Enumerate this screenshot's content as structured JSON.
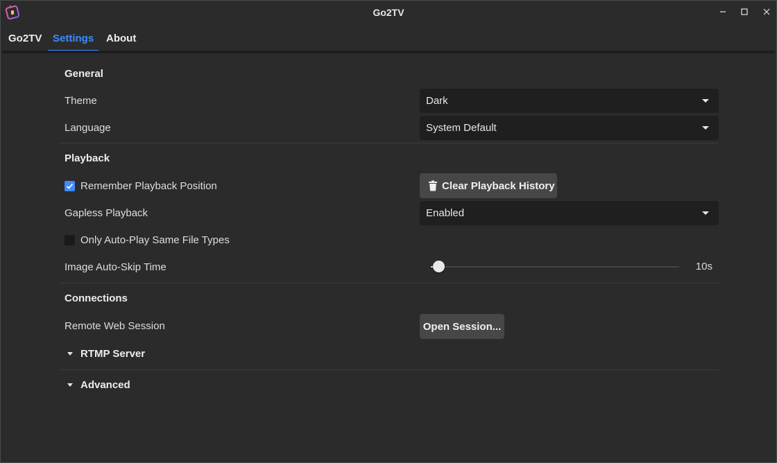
{
  "window": {
    "title": "Go2TV"
  },
  "tabs": [
    {
      "label": "Go2TV",
      "active": false
    },
    {
      "label": "Settings",
      "active": true
    },
    {
      "label": "About",
      "active": false
    }
  ],
  "sections": {
    "general": {
      "title": "General",
      "theme": {
        "label": "Theme",
        "value": "Dark"
      },
      "language": {
        "label": "Language",
        "value": "System Default"
      }
    },
    "playback": {
      "title": "Playback",
      "remember_position": {
        "label": "Remember Playback Position",
        "checked": true
      },
      "clear_history": {
        "label": "Clear Playback History"
      },
      "gapless": {
        "label": "Gapless Playback",
        "value": "Enabled"
      },
      "same_types": {
        "label": "Only Auto-Play Same File Types",
        "checked": false
      },
      "auto_skip": {
        "label": "Image Auto-Skip Time",
        "value": "10s",
        "fraction": 0.03
      }
    },
    "connections": {
      "title": "Connections",
      "remote_session": {
        "label": "Remote Web Session",
        "button": "Open Session..."
      },
      "rtmp": {
        "label": "RTMP Server"
      },
      "advanced": {
        "label": "Advanced"
      }
    }
  },
  "colors": {
    "accent": "#3d8bfd",
    "background": "#2b2b2b",
    "input": "#1f1f1f",
    "button": "#474747"
  }
}
